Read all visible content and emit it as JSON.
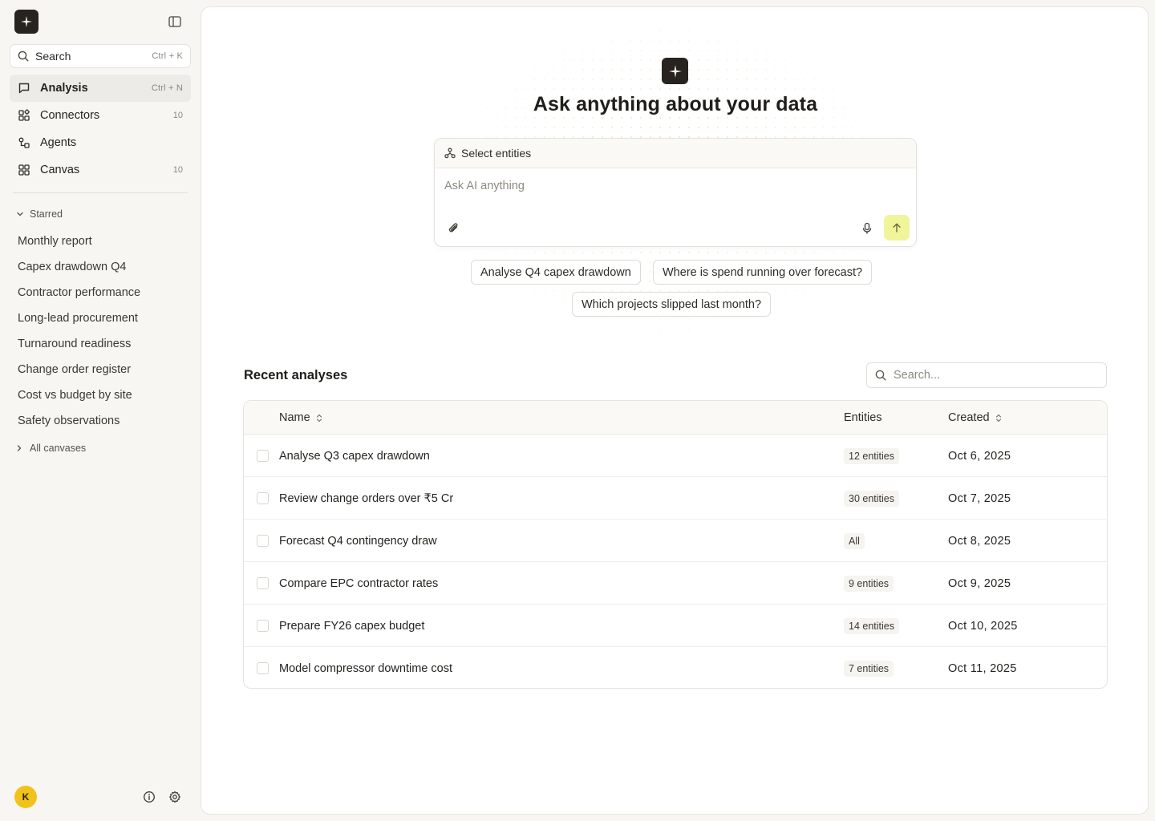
{
  "sidebar": {
    "search": {
      "label": "Search",
      "shortcut": "Ctrl + K"
    },
    "nav": [
      {
        "label": "Analysis",
        "shortcut": "Ctrl + N",
        "active": true,
        "icon": "chat-bubble-icon"
      },
      {
        "label": "Connectors",
        "count": "10",
        "icon": "connectors-icon"
      },
      {
        "label": "Agents",
        "count": "",
        "icon": "agents-icon"
      },
      {
        "label": "Canvas",
        "count": "10",
        "icon": "grid-icon"
      }
    ],
    "starred_label": "Starred",
    "starred": [
      "Monthly report",
      "Capex drawdown Q4",
      "Contractor performance",
      "Long-lead procurement",
      "Turnaround readiness",
      "Change order register",
      "Cost vs budget by site",
      "Safety observations"
    ],
    "all_canvases_label": "All canvases",
    "user_initial": "K"
  },
  "hero": {
    "title": "Ask anything about your data"
  },
  "composer": {
    "select_entities_label": "Select entities",
    "placeholder": "Ask AI anything"
  },
  "suggestions": [
    "Analyse Q4 capex drawdown",
    "Where is spend running over forecast?",
    "Which projects slipped last month?"
  ],
  "recent": {
    "title": "Recent analyses",
    "search_placeholder": "Search...",
    "columns": {
      "name": "Name",
      "entities": "Entities",
      "created": "Created"
    },
    "rows": [
      {
        "name": "Analyse Q3 capex drawdown",
        "entities": "12 entities",
        "created": "Oct 6, 2025"
      },
      {
        "name": "Review change orders over ₹5 Cr",
        "entities": "30 entities",
        "created": "Oct 7, 2025"
      },
      {
        "name": "Forecast Q4 contingency draw",
        "entities": "All",
        "created": "Oct 8, 2025"
      },
      {
        "name": "Compare EPC contractor rates",
        "entities": "9 entities",
        "created": "Oct 9, 2025"
      },
      {
        "name": "Prepare FY26 capex budget",
        "entities": "14 entities",
        "created": "Oct 10, 2025"
      },
      {
        "name": "Model compressor downtime cost",
        "entities": "7 entities",
        "created": "Oct 11, 2025"
      }
    ]
  },
  "colors": {
    "accent": "#f1f59a",
    "logo_bg": "#27241f",
    "avatar": "#f1c21b",
    "sidebar_bg": "#f7f6f3"
  }
}
